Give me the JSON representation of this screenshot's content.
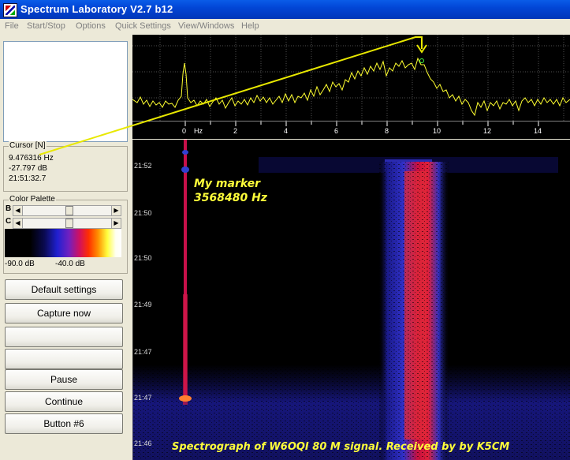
{
  "window": {
    "title": "Spectrum Laboratory V2.7 b12",
    "icon": "spectrum-app-icon"
  },
  "menu": [
    "File",
    "Start/Stop",
    "Options",
    "Quick Settings",
    "View/Windows",
    "Help"
  ],
  "cursor": {
    "label": "Cursor [N]",
    "freq": "9.476316 Hz",
    "level": "-27.797 dB",
    "time": "21:51:32.7"
  },
  "palette": {
    "label": "Color Palette",
    "b_label": "B",
    "c_label": "C",
    "min_db": "-90.0 dB",
    "max_db": "-40.0 dB"
  },
  "buttons": [
    "Default settings",
    "Capture now",
    "",
    "",
    "Pause",
    "Continue",
    "Button #6"
  ],
  "spectrum": {
    "freq_unit": "Hz",
    "freq_ticks": [
      "0",
      "2",
      "4",
      "6",
      "8",
      "10",
      "12",
      "14"
    ],
    "line_color": "#ffff30"
  },
  "waterfall": {
    "time_labels": [
      "21:52",
      "21:50",
      "21:50",
      "21:49",
      "21:47",
      "21:47",
      "21:46"
    ],
    "marker_text_line1": "My marker",
    "marker_text_line2": "3568480 Hz",
    "caption": "Spectrograph of W6OQI 80 M signal.  Received by by K5CM"
  }
}
